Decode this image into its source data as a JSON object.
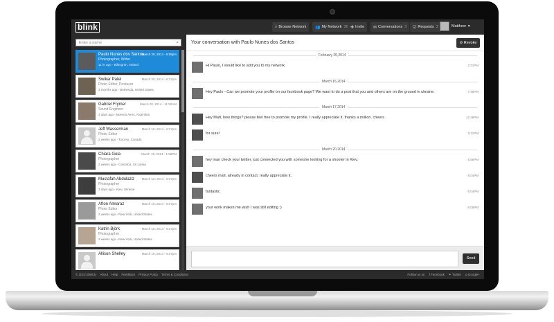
{
  "brand": {
    "logo": "blink"
  },
  "nav": [
    {
      "icon": "search-icon",
      "label": "Browse Network",
      "count": ""
    },
    {
      "icon": "people-icon",
      "label": "My Network",
      "count": "360"
    },
    {
      "icon": "plus-icon",
      "label": "Invite",
      "count": ""
    },
    {
      "icon": "mail-icon",
      "label": "Conversations",
      "count": "3"
    },
    {
      "icon": "check-icon",
      "label": "Requests",
      "count": "3"
    }
  ],
  "user": {
    "name": "Matthew",
    "caret": "▾"
  },
  "search": {
    "placeholder": "Enter a name",
    "icon": "⌕"
  },
  "contacts": [
    {
      "name": "Paulo Nunes dos Santos",
      "role": "Photographer, Writer",
      "meta": "11 hr ago - Bilbogran, Ireland",
      "date": "March 20, 2014 - 8:08pm"
    },
    {
      "name": "Swikar Patel",
      "role": "Photo Editor, Producer",
      "meta": "3 months ago - Bethesda, United States",
      "date": "March 20, 2014 - 6:27pm"
    },
    {
      "name": "Gabriel Frymer",
      "role": "Sound Engineer",
      "meta": "2 days ago - Buenos Aires, Argentina",
      "date": "March 20, 2014 - 11:50AM"
    },
    {
      "name": "Jeff Wasserman",
      "role": "Photo Editor",
      "meta": "2 weeks ago - Toronto, Canada",
      "date": "March 19, 2014 - 6:27pm"
    },
    {
      "name": "Chiara Goia",
      "role": "Photographer",
      "meta": "2 weeks ago - Colombo, Sri Lanka",
      "date": "March 19, 2014 - 1:58PM"
    },
    {
      "name": "Mustafah Abdulaziz",
      "role": "Photographer",
      "meta": "3 days ago - Kiev, Ukraine",
      "date": "March 19, 2014 - 6:27pm"
    },
    {
      "name": "Afton Almaraz",
      "role": "Photo Editor",
      "meta": "2 weeks ago - New York, United States",
      "date": "March 19, 2014 - 6:27pm"
    },
    {
      "name": "Katrin Björk",
      "role": "Photographer",
      "meta": "2 weeks ago - New York, United States",
      "date": "March 19, 2014 - 6:27pm"
    },
    {
      "name": "Allison Shelley",
      "role": "",
      "meta": "",
      "date": "March 19, 2014 - 6:27pm"
    }
  ],
  "conversation": {
    "title": "Your conversation with Paulo Nunes dos Santos",
    "revoke_label": "Revoke",
    "days": [
      {
        "date": "February 20,2014",
        "messages": [
          {
            "text": "Hi Paulo, I would like to add you to my network.",
            "time": "2:31PM"
          }
        ]
      },
      {
        "date": "March 16,2014",
        "messages": [
          {
            "text": "Hey Paulo - Can we promote your profile on our facebook page? We want to do a post that you and others are on the ground in ukraine.",
            "time": "7:46PM"
          }
        ]
      },
      {
        "date": "March 17,2014",
        "messages": [
          {
            "text": "Hey Matt, how things? please feel free to promote my profile. I really appreciate it. thanks a million. cheers",
            "time": "12:46PM"
          },
          {
            "text": "for sure!",
            "time": "5:11PM"
          }
        ]
      },
      {
        "date": "March 20,2014",
        "messages": [
          {
            "text": "hey man check your twitter, just connected you with someone looking for a shooter in Kiev.",
            "time": "5:56PM"
          },
          {
            "text": "cheers matt. already in contact. really appreciate it.",
            "time": "6:04PM"
          },
          {
            "text": "fantastic",
            "time": "6:04PM"
          },
          {
            "text": "your work makes me wish I was still editing :)",
            "time": "6:05PM"
          }
        ]
      }
    ]
  },
  "compose": {
    "send_label": "Send"
  },
  "footer": {
    "links": [
      "© 2013 Blink3x",
      "About",
      "Help",
      "Feedback",
      "Privacy Policy",
      "Terms & Conditions"
    ],
    "follow": "Follow us on",
    "social": [
      "Facebook",
      "Twitter",
      "Google+"
    ]
  }
}
